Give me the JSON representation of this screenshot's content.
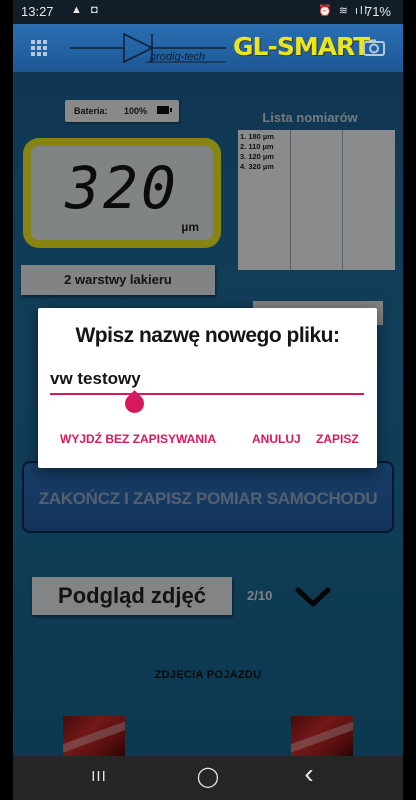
{
  "status_bar": {
    "time": "13:27",
    "left_icons": "▲ ◘",
    "right_icons": "⏰ ≋ ıll",
    "battery": "71%"
  },
  "app_bar": {
    "logo_text": "prodig-tech",
    "brand": "GL-SMART"
  },
  "battery_pill": {
    "label": "Bateria:",
    "value": "100%"
  },
  "gauge": {
    "value": "320",
    "unit": "µm"
  },
  "measurements": {
    "title": "Lista nomiarów",
    "items": [
      "1. 180 µm",
      "2. 110 µm",
      "3. 120 µm",
      "4. 320 µm"
    ]
  },
  "layers_button": "2 warstwy lakieru",
  "finish_button": "ZAKOŃCZ I ZAPISZ POMIAR SAMOCHODU",
  "preview": {
    "label": "Podgląd zdjęć",
    "count": "2/10"
  },
  "photos_label": "ZDJĘCIA POJAZDU",
  "dialog": {
    "title": "Wpisz nazwę nowego pliku:",
    "input_value": "vw testowy",
    "buttons": {
      "exit": "WYJDŹ BEZ ZAPISYWANIA",
      "cancel": "ANULUJ",
      "save": "ZAPISZ"
    }
  },
  "nav_bar": {
    "recents": "III",
    "home": "◯",
    "back": "‹"
  },
  "colors": {
    "accent": "#d6195e",
    "brand_yellow": "#e9e61e",
    "app_bar": "#2a6fb2"
  }
}
